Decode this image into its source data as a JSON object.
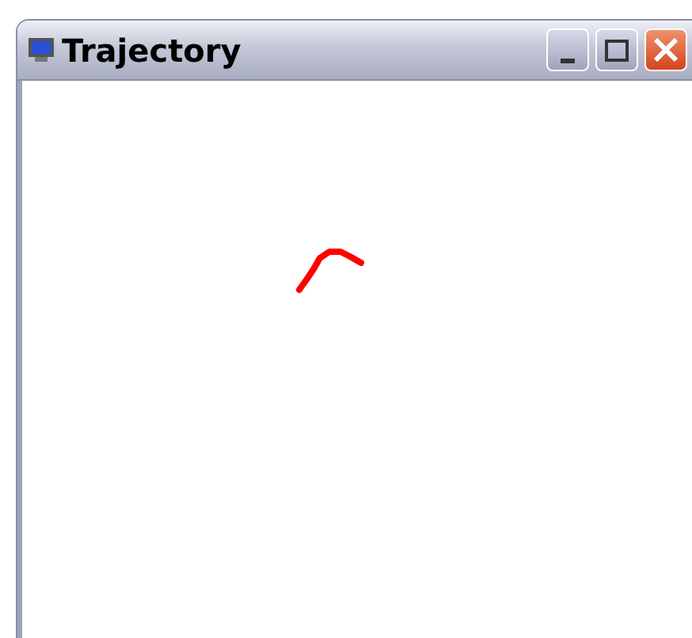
{
  "window": {
    "title": "Trajectory"
  }
}
